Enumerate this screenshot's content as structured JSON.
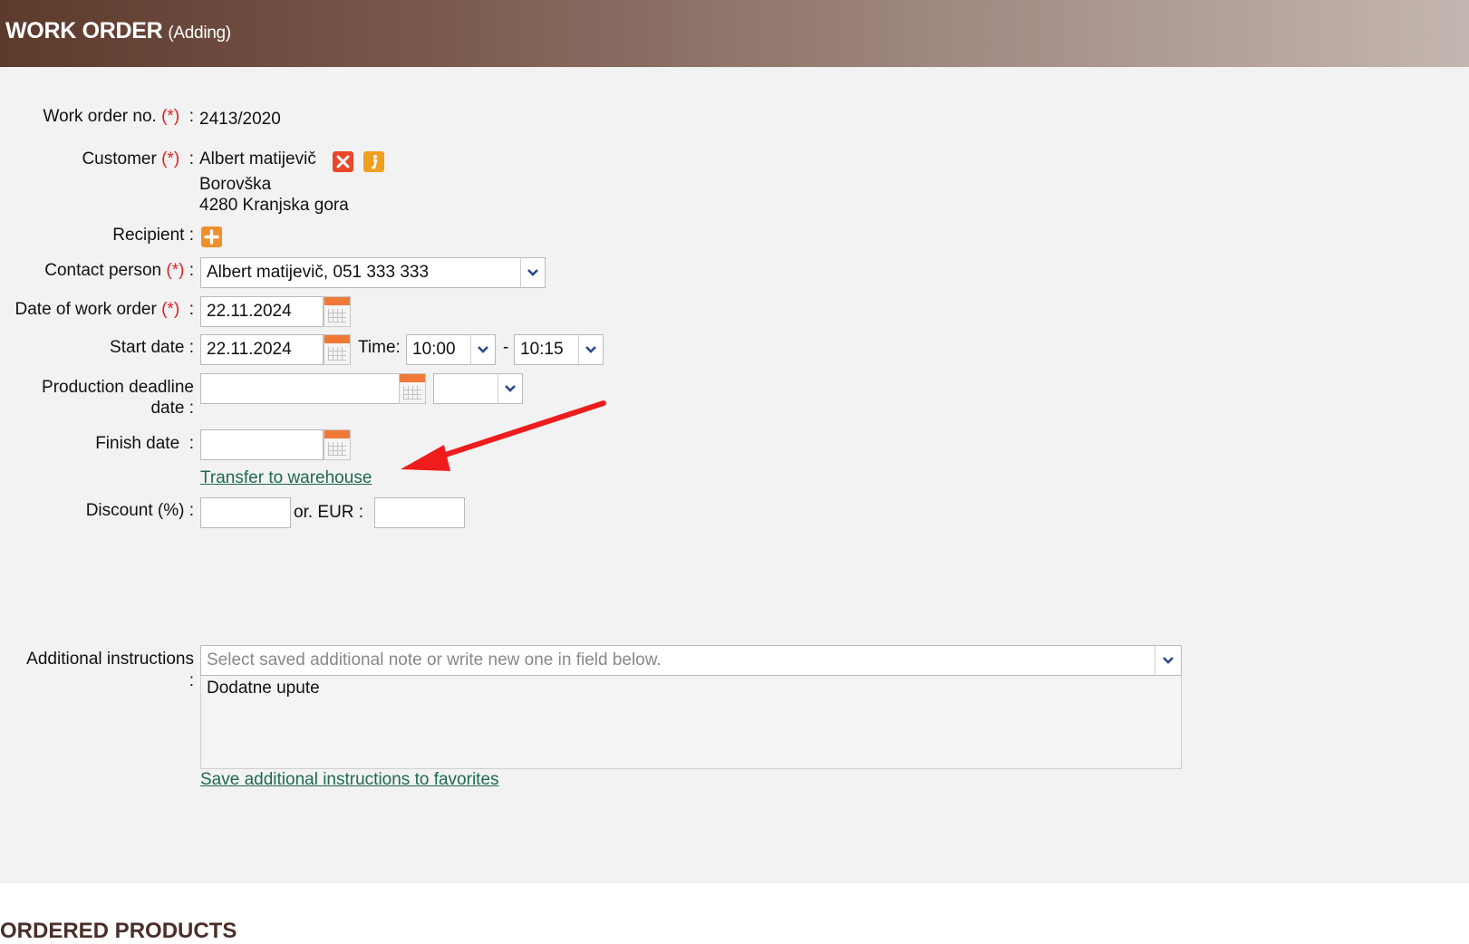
{
  "header": {
    "title": "WORK ORDER",
    "subtitle": "(Adding)"
  },
  "form": {
    "work_order_no": {
      "label": "Work order no.",
      "required": "(*)",
      "sep": ":",
      "value": "2413/2020"
    },
    "customer": {
      "label": "Customer",
      "required": "(*)",
      "sep": ":",
      "name": "Albert matijevič",
      "street": "Borovška",
      "city": "4280 Kranjska gora",
      "remove_icon": "remove-x-icon",
      "info_icon": "info-icon"
    },
    "recipient": {
      "label": "Recipient :",
      "add_icon": "add-plus-icon"
    },
    "contact_person": {
      "label": "Contact person",
      "required": "(*)",
      "sep": ":",
      "value": "Albert matijevič, 051 333 333"
    },
    "date_of_work_order": {
      "label": "Date of work order",
      "required": "(*)",
      "sep": ":",
      "value": "22.11.2024"
    },
    "start_date": {
      "label": "Start date :",
      "value": "22.11.2024",
      "time_label": "Time:",
      "time_from": "10:00",
      "dash": "-",
      "time_to": "10:15"
    },
    "production_deadline": {
      "label_line1": "Production deadline",
      "label_line2": "date :",
      "value": "",
      "time": ""
    },
    "finish_date": {
      "label": "Finish date",
      "sep": ":",
      "value": ""
    },
    "transfer_link": "Transfer to warehouse",
    "discount": {
      "label": "Discount (%) :",
      "value": "",
      "or_label": "or. EUR :",
      "eur_value": ""
    },
    "additional_instructions": {
      "label_line1": "Additional instructions",
      "label_line2": ":",
      "placeholder": "Select saved additional note or write new one in field below.",
      "text": "Dodatne upute",
      "save_link": "Save additional instructions to favorites"
    }
  },
  "ordered_products_title": "ORDERED PRODUCTS",
  "colors": {
    "required": "#e02020",
    "link": "#1f6a4e",
    "calendar_accent": "#f07a35",
    "annotation_arrow": "#ee1c1c"
  },
  "icons": {
    "dropdown": "chevron-down-icon",
    "calendar": "calendar-icon"
  }
}
